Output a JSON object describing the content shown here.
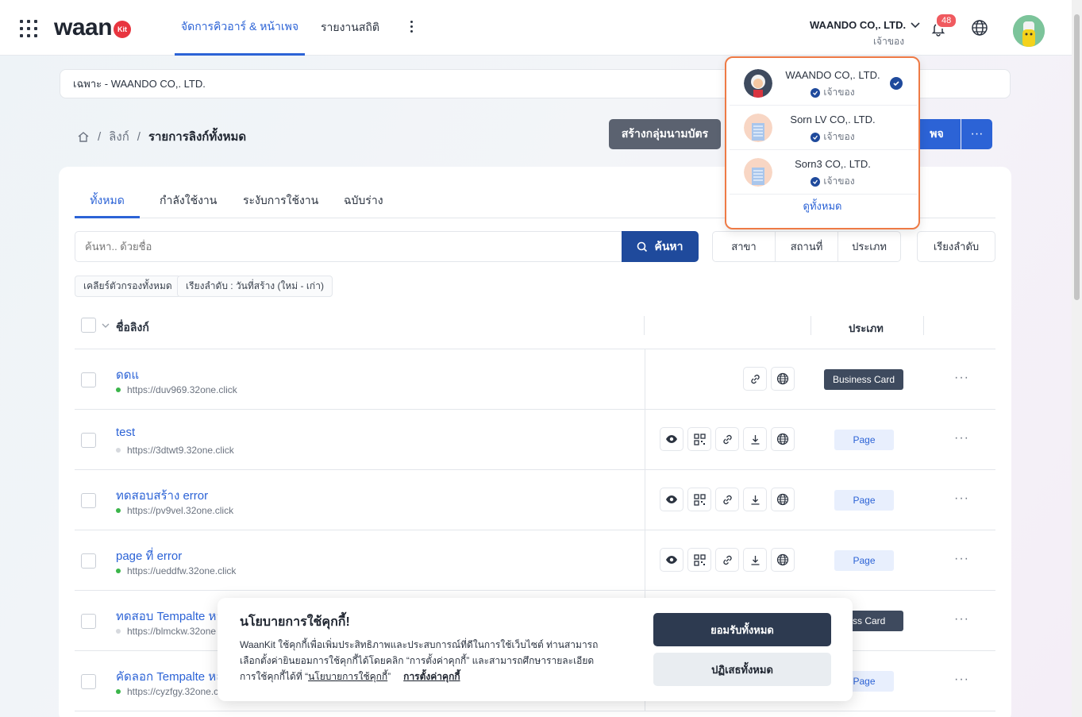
{
  "header": {
    "logo_text": "waan",
    "logo_badge": "Kit",
    "nav": [
      {
        "label": "จัดการคิวอาร์ & หน้าเพจ",
        "active": true
      },
      {
        "label": "รายงานสถิติ",
        "active": false
      }
    ],
    "account_name": "WAANDO CO,. LTD.",
    "account_role": "เจ้าของ",
    "notification_count": "48"
  },
  "scope_bar": {
    "text": "เฉพาะ - WAANDO CO,. LTD."
  },
  "breadcrumb": {
    "item1": "ลิงก์",
    "current": "รายการลิงก์ทั้งหมด"
  },
  "actions": {
    "create_group": "สร้างกลุ่มนามบัตร",
    "primary_partial": "พจ",
    "more": "···"
  },
  "tabs": [
    "ทั้งหมด",
    "กำลังใช้งาน",
    "ระงับการใช้งาน",
    "ฉบับร่าง"
  ],
  "search": {
    "placeholder": "ค้นหา.. ด้วยชื่อ",
    "button": "ค้นหา"
  },
  "filters": [
    "สาขา",
    "สถานที่",
    "ประเภท"
  ],
  "sort_label": "เรียงลำดับ",
  "chips": [
    "เคลียร์ตัวกรองทั้งหมด",
    "เรียงลำดับ : วันที่สร้าง (ใหม่ - เก่า)"
  ],
  "table": {
    "col_name": "ชื่อลิงก์",
    "col_type": "ประเภท",
    "rows": [
      {
        "title": "ดดแ",
        "url": "https://duv969.32one.click",
        "status": "on",
        "type": "Business Card",
        "kind": "card"
      },
      {
        "title": "test",
        "url": "https://3dtwt9.32one.click",
        "status": "off",
        "type": "Page",
        "kind": "page"
      },
      {
        "title": "ทดสอบสร้าง error",
        "url": "https://pv9vel.32one.click",
        "status": "on",
        "type": "Page",
        "kind": "page"
      },
      {
        "title": "page ที่ error",
        "url": "https://ueddfw.32one.click",
        "status": "on",
        "type": "Page",
        "kind": "page"
      },
      {
        "title": "ทดสอบ Tempalte หล",
        "url": "https://blmckw.32one",
        "status": "off",
        "type": "ness Card",
        "kind": "card"
      },
      {
        "title": "คัดลอก Tempalte หล",
        "url": "https://cyzfgy.32one.c",
        "status": "on",
        "type": "Page",
        "kind": "page"
      }
    ]
  },
  "account_dropdown": {
    "items": [
      {
        "name": "WAANDO CO,. LTD.",
        "role": "เจ้าของ",
        "selected": true
      },
      {
        "name": "Sorn LV CO,. LTD.",
        "role": "เจ้าของ",
        "selected": false
      },
      {
        "name": "Sorn3 CO,. LTD.",
        "role": "เจ้าของ",
        "selected": false
      }
    ],
    "view_all": "ดูทั้งหมด"
  },
  "cookie": {
    "title": "นโยบายการใช้คุกกี้!",
    "line1": "WaanKit ใช้คุกกี้เพื่อเพิ่มประสิทธิภาพและประสบการณ์ที่ดีในการใช้เว็บไซต์ ท่านสามารถ",
    "line2": "เลือกตั้งค่ายินยอมการใช้คุกกี้ได้โดยคลิก “การตั้งค่าคุกกี้” และสามารถศึกษารายละเอียด",
    "line3_prefix": "การใช้คุกกี้ได้ที่ “",
    "policy_link": "นโยบายการใช้คุกกี้",
    "line3_suffix": "”",
    "settings_link": "การตั้งค่าคุกกี้",
    "accept": "ยอมรับทั้งหมด",
    "reject": "ปฏิเสธทั้งหมด"
  },
  "colors": {
    "primary": "#2c63d6",
    "dark_navy": "#1f4a9c",
    "highlight": "#ee7a45",
    "badge": "#f05a5f"
  }
}
